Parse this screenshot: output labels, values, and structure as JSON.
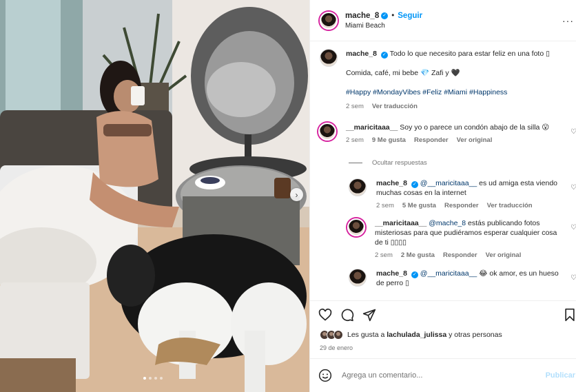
{
  "post": {
    "username": "mache_8",
    "follow_label": "Seguir",
    "separator": "•",
    "location": "Miami Beach",
    "more_icon": "more-options-icon"
  },
  "carousel": {
    "current_index": 1,
    "total": 4
  },
  "caption": {
    "username": "mache_8",
    "line1": "Todo lo que necesito para estar feliz en una foto ▯",
    "line2": "Comida, café, mi bebe 💎 Zafi y 🖤",
    "hashtags": "#Happy #MondayVibes #Feliz #Miami #Happiness",
    "time": "2 sem",
    "translate": "Ver traducción"
  },
  "comments": [
    {
      "username": "__maricitaaa__",
      "text": "Soy yo o parece un condón abajo de la silla 😮",
      "time": "2 sem",
      "likes": "9 Me gusta",
      "reply": "Responder",
      "extra": "Ver original"
    }
  ],
  "hide_replies": "Ocultar respuestas",
  "replies": [
    {
      "username": "mache_8",
      "mention": "@__maricitaaa__",
      "text": "es ud amiga esta viendo muchas cosas en la internet",
      "time": "2 sem",
      "likes": "5 Me gusta",
      "reply": "Responder",
      "extra": "Ver traducción"
    },
    {
      "username": "__maricitaaa__",
      "mention": "@mache_8",
      "text": "estás publicando fotos misteriosas para que pudiéramos esperar cualquier cosa de ti ▯▯▯▯",
      "time": "2 sem",
      "likes": "2 Me gusta",
      "reply": "Responder",
      "extra": "Ver original"
    },
    {
      "username": "mache_8",
      "mention": "@__maricitaaa__",
      "text": "😂 ok amor, es un hueso de perro ▯",
      "time": "",
      "likes": "",
      "reply": "",
      "extra": ""
    }
  ],
  "likes_line": {
    "prefix": "Les gusta a",
    "user": "lachulada_julissa",
    "suffix": "y otras personas"
  },
  "date": "29 de enero",
  "add_comment": {
    "placeholder": "Agrega un comentario...",
    "publish": "Publicar"
  },
  "colors": {
    "link_blue": "#0095f6",
    "hashtag": "#00376b",
    "muted": "#737373"
  }
}
